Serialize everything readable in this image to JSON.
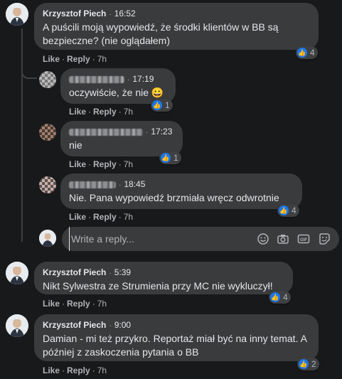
{
  "comments": [
    {
      "name": "Krzysztof Piech",
      "time": "16:52",
      "text": "A puścili moją wypowiedź, że środki klientów w BB są bezpieczne? (nie oglądałem)",
      "likes": "4"
    },
    {
      "time": "17:19",
      "text": "oczywiście, że nie 😀",
      "likes": "1"
    },
    {
      "time": "17:23",
      "text": "nie",
      "likes": "1"
    },
    {
      "time": "18:45",
      "text": "Nie. Pana wypowiedź brzmiała wręcz odwrotnie",
      "likes": "4"
    },
    {
      "name": "Krzysztof Piech",
      "time": "5:39",
      "text": "Nikt Sylwestra ze Strumienia przy MC nie wykluczył!",
      "likes": "4"
    },
    {
      "name": "Krzysztof Piech",
      "time": "9:00",
      "text": "Damian - mi też przykro. Reportaż miał być na inny temat. A później z zaskoczenia pytania o BB",
      "likes": "2"
    }
  ],
  "actions": {
    "like": "Like",
    "reply": "Reply",
    "sep": "·"
  },
  "ages": [
    "7h",
    "7h",
    "7h",
    "7h",
    "7h",
    "7h"
  ],
  "reply_placeholder": "Write a reply...",
  "icons": {
    "like": "like-icon",
    "emoji": "emoji-icon",
    "camera": "camera-icon",
    "gif": "gif-icon",
    "sticker": "sticker-icon"
  },
  "colors": {
    "background": "#18191a",
    "bubble": "#3a3b3c",
    "like_blue": "#1877f2"
  }
}
